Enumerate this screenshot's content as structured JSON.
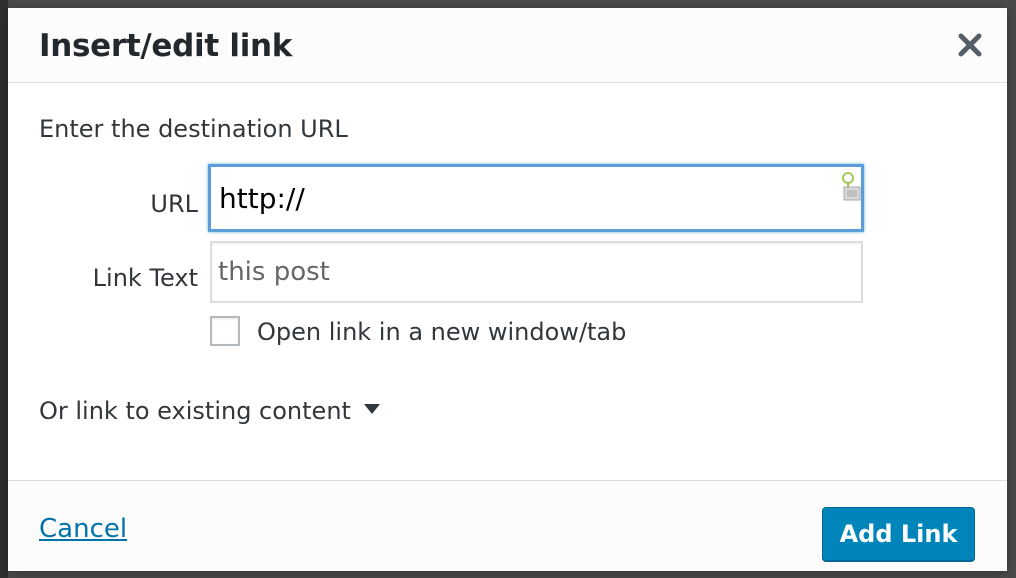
{
  "dialog": {
    "title": "Insert/edit link",
    "close_icon": "close-icon"
  },
  "form": {
    "intro": "Enter the destination URL",
    "url_label": "URL",
    "url_value": "http://",
    "link_text_label": "Link Text",
    "link_text_value": "this post",
    "new_tab_label": "Open link in a new window/tab",
    "new_tab_checked": false,
    "existing_content_toggle": "Or link to existing content"
  },
  "footer": {
    "cancel_label": "Cancel",
    "add_link_label": "Add Link"
  },
  "colors": {
    "primary_button": "#0085ba",
    "link": "#0073aa",
    "focus_border": "#5b9dd9"
  }
}
